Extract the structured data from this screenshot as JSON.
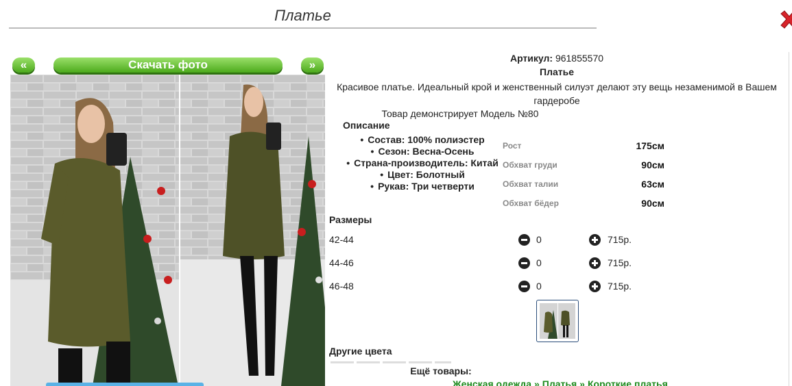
{
  "header": {
    "title": "Платье"
  },
  "gallery": {
    "prev_label": "«",
    "next_label": "»",
    "download_label": "Скачать фото"
  },
  "product": {
    "article_label": "Артикул:",
    "article_value": "961855570",
    "name": "Платье",
    "description": "Красивое платье. Идеальный крой и женственный силуэт делают эту вещь незаменимой в Вашем гардеробе",
    "model_note": "Товар демонстрирует Модель №80"
  },
  "description_section": {
    "heading": "Описание",
    "properties": [
      "Состав: 100% полиэстер",
      "Сезон: Весна-Осень",
      "Страна-производитель: Китай",
      "Цвет: Болотный",
      "Рукав: Три четверти"
    ]
  },
  "model_measurements": [
    {
      "label": "Рост",
      "value": "175см"
    },
    {
      "label": "Обхват груди",
      "value": "90см"
    },
    {
      "label": "Обхват талии",
      "value": "63см"
    },
    {
      "label": "Обхват бёдер",
      "value": "90см"
    }
  ],
  "sizes": {
    "heading": "Размеры",
    "rows": [
      {
        "size": "42-44",
        "qty": "0",
        "price": "715р."
      },
      {
        "size": "44-46",
        "qty": "0",
        "price": "715р."
      },
      {
        "size": "46-48",
        "qty": "0",
        "price": "715р."
      }
    ]
  },
  "other_colors": {
    "heading": "Другие цвета"
  },
  "more_goods": {
    "heading": "Ещё товары:",
    "breadcrumbs": [
      "Женская одежда",
      "Платья",
      "Короткие платья"
    ],
    "separator": "»"
  },
  "colors": {
    "accent_green": "#4caa1c",
    "link_green": "#1c8a1c",
    "close_red": "#d8232a"
  }
}
